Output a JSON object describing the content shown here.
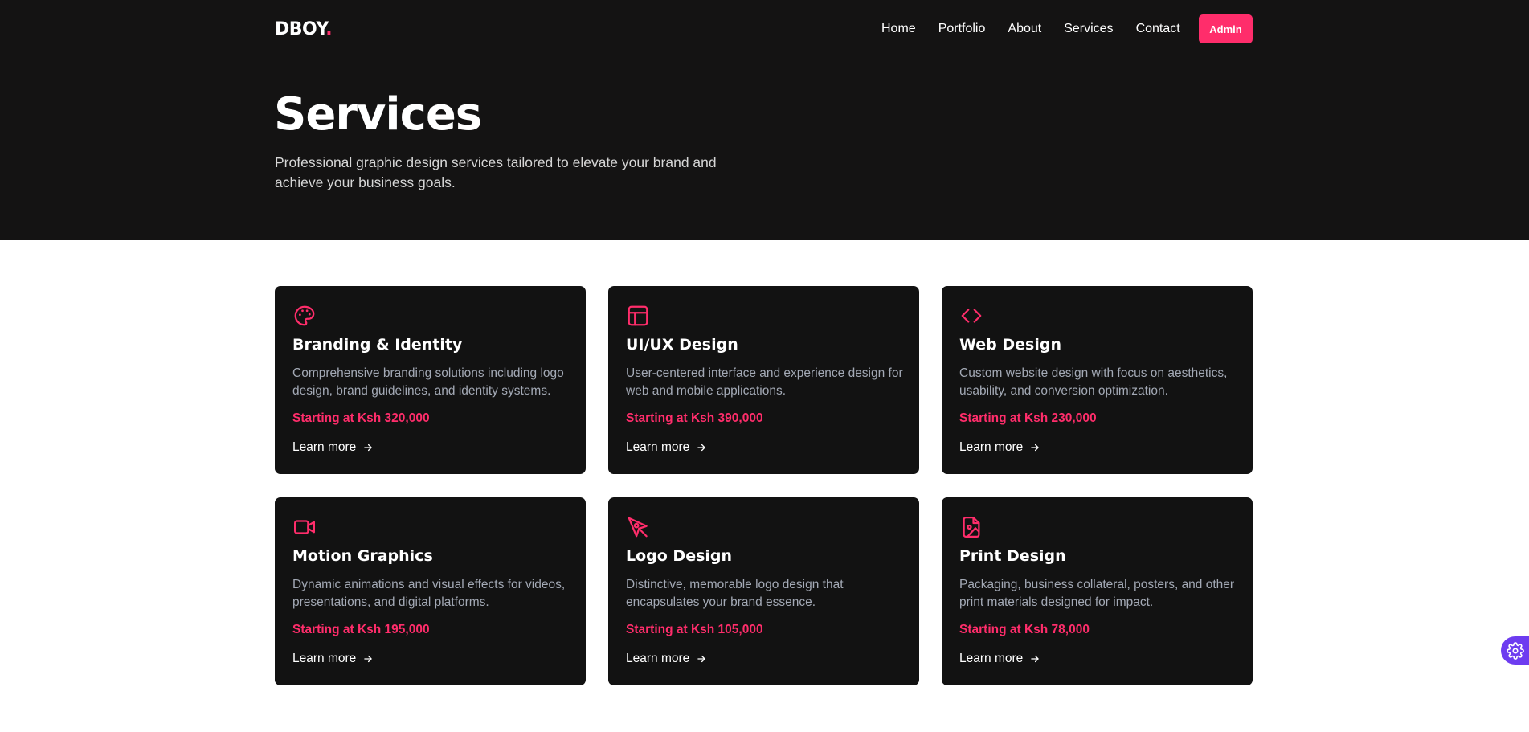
{
  "header": {
    "logo_text": "DBOY",
    "logo_dot": ".",
    "nav": [
      "Home",
      "Portfolio",
      "About",
      "Services",
      "Contact"
    ],
    "admin_label": "Admin"
  },
  "hero": {
    "title": "Services",
    "subtitle": "Professional graphic design services tailored to elevate your brand and achieve your business goals."
  },
  "services": [
    {
      "icon": "palette-icon",
      "title": "Branding & Identity",
      "description": "Comprehensive branding solutions including logo design, brand guidelines, and identity systems.",
      "price": "Starting at Ksh 320,000",
      "link": "Learn more"
    },
    {
      "icon": "layout-icon",
      "title": "UI/UX Design",
      "description": "User-centered interface and experience design for web and mobile applications.",
      "price": "Starting at Ksh 390,000",
      "link": "Learn more"
    },
    {
      "icon": "code-icon",
      "title": "Web Design",
      "description": "Custom website design with focus on aesthetics, usability, and conversion optimization.",
      "price": "Starting at Ksh 230,000",
      "link": "Learn more"
    },
    {
      "icon": "video-camera-icon",
      "title": "Motion Graphics",
      "description": "Dynamic animations and visual effects for videos, presentations, and digital platforms.",
      "price": "Starting at Ksh 195,000",
      "link": "Learn more"
    },
    {
      "icon": "pen-tool-icon",
      "title": "Logo Design",
      "description": "Distinctive, memorable logo design that encapsulates your brand essence.",
      "price": "Starting at Ksh 105,000",
      "link": "Learn more"
    },
    {
      "icon": "file-image-icon",
      "title": "Print Design",
      "description": "Packaging, business collateral, posters, and other print materials designed for impact.",
      "price": "Starting at Ksh 78,000",
      "link": "Learn more"
    }
  ],
  "colors": {
    "accent": "#ff2d6b",
    "hero_bg": "#141313",
    "card_bg": "#121212",
    "fab_bg": "#6d3cf0"
  }
}
